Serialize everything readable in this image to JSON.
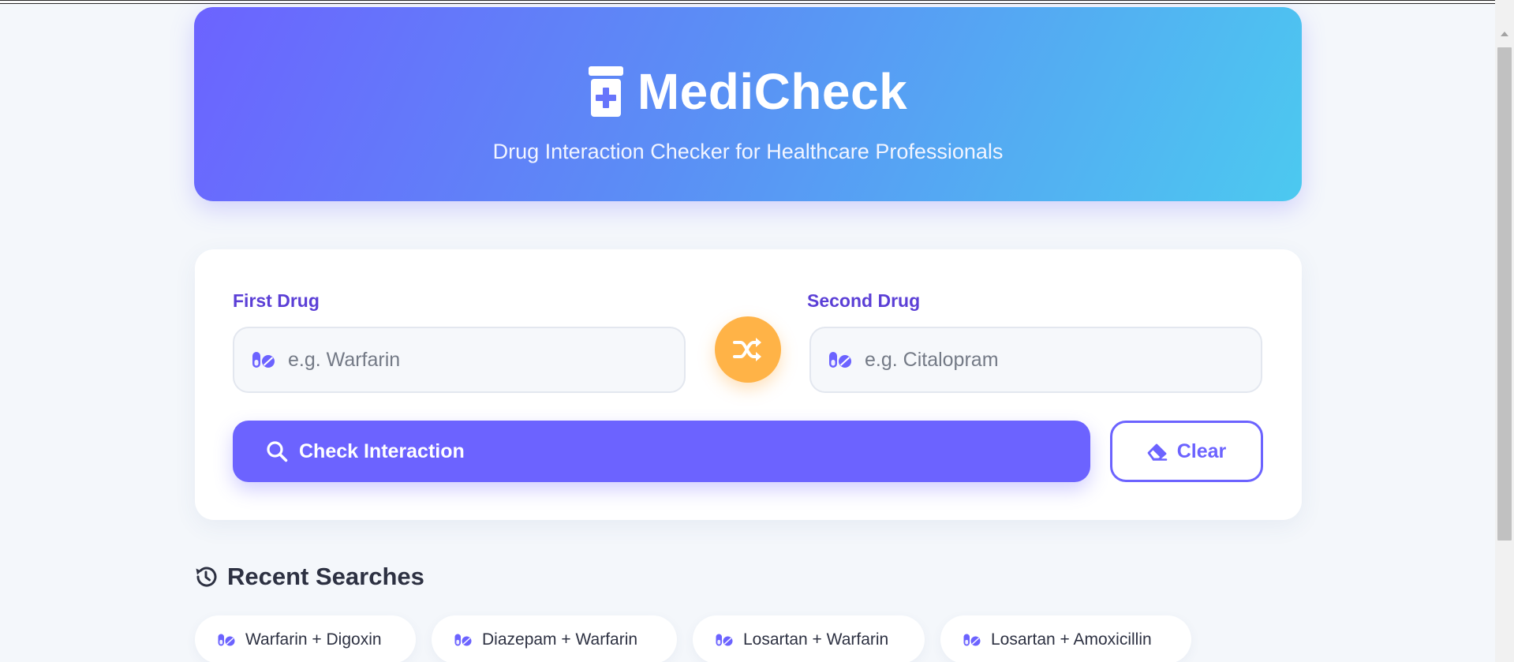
{
  "header": {
    "title": "MediCheck",
    "subtitle": "Drug Interaction Checker for Healthcare Professionals",
    "logo_icon": "prescription-bottle-medical-icon"
  },
  "form": {
    "first_drug": {
      "label": "First Drug",
      "placeholder": "e.g. Warfarin",
      "value": "",
      "icon": "pills-icon"
    },
    "second_drug": {
      "label": "Second Drug",
      "placeholder": "e.g. Citalopram",
      "value": "",
      "icon": "pills-icon"
    },
    "swap_icon": "shuffle-icon",
    "check_button": {
      "label": "Check Interaction",
      "icon": "search-icon"
    },
    "clear_button": {
      "label": "Clear",
      "icon": "eraser-icon"
    }
  },
  "recent": {
    "title": "Recent Searches",
    "icon": "history-icon",
    "items": [
      {
        "label": "Warfarin + Digoxin"
      },
      {
        "label": "Diazepam + Warfarin"
      },
      {
        "label": "Losartan + Warfarin"
      },
      {
        "label": "Losartan + Amoxicillin"
      }
    ]
  },
  "colors": {
    "accent": "#6c63ff",
    "label": "#5b3fd6",
    "swap": "#ffb347",
    "gradient_start": "#6c63ff",
    "gradient_end": "#4cc9f0",
    "background": "#f4f7fb"
  }
}
